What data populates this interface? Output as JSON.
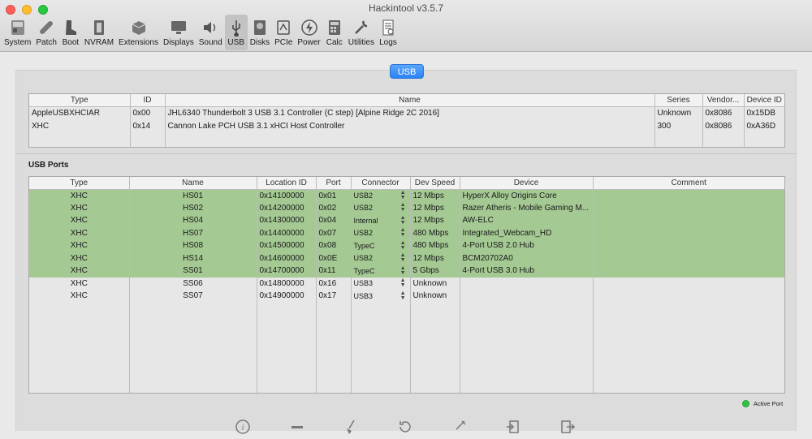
{
  "window": {
    "title": "Hackintool v3.5.7"
  },
  "toolbar": [
    {
      "label": "System",
      "icon": "system-icon"
    },
    {
      "label": "Patch",
      "icon": "patch-icon"
    },
    {
      "label": "Boot",
      "icon": "boot-icon"
    },
    {
      "label": "NVRAM",
      "icon": "nvram-icon"
    },
    {
      "label": "Extensions",
      "icon": "extensions-icon"
    },
    {
      "label": "Displays",
      "icon": "displays-icon"
    },
    {
      "label": "Sound",
      "icon": "sound-icon"
    },
    {
      "label": "USB",
      "icon": "usb-icon",
      "active": true
    },
    {
      "label": "Disks",
      "icon": "disks-icon"
    },
    {
      "label": "PCIe",
      "icon": "pcie-icon"
    },
    {
      "label": "Power",
      "icon": "power-icon"
    },
    {
      "label": "Calc",
      "icon": "calc-icon"
    },
    {
      "label": "Utilities",
      "icon": "utilities-icon"
    },
    {
      "label": "Logs",
      "icon": "logs-icon"
    }
  ],
  "tab_label": "USB",
  "controllers": {
    "headers": [
      "Type",
      "ID",
      "Name",
      "Series",
      "Vendor...",
      "Device ID"
    ],
    "rows": [
      [
        "AppleUSBXHCIAR",
        "0x00",
        "JHL6340 Thunderbolt 3 USB 3.1 Controller (C step) [Alpine Ridge 2C 2016]",
        "Unknown",
        "0x8086",
        "0x15DB"
      ],
      [
        "XHC",
        "0x14",
        "Cannon Lake PCH USB 3.1 xHCI Host Controller",
        "300",
        "0x8086",
        "0xA36D"
      ]
    ]
  },
  "ports": {
    "title": "USB Ports",
    "headers": [
      "Type",
      "Name",
      "Location ID",
      "Port",
      "Connector",
      "Dev Speed",
      "Device",
      "Comment"
    ],
    "rows": [
      {
        "type": "XHC",
        "name": "HS01",
        "location": "0x14100000",
        "port": "0x01",
        "connector": "USB2",
        "speed": "12 Mbps",
        "device": "HyperX Alloy Origins Core",
        "comment": "",
        "active": true
      },
      {
        "type": "XHC",
        "name": "HS02",
        "location": "0x14200000",
        "port": "0x02",
        "connector": "USB2",
        "speed": "12 Mbps",
        "device": "Razer Atheris - Mobile Gaming M...",
        "comment": "",
        "active": true
      },
      {
        "type": "XHC",
        "name": "HS04",
        "location": "0x14300000",
        "port": "0x04",
        "connector": "Internal",
        "speed": "12 Mbps",
        "device": "AW-ELC",
        "comment": "",
        "active": true
      },
      {
        "type": "XHC",
        "name": "HS07",
        "location": "0x14400000",
        "port": "0x07",
        "connector": "USB2",
        "speed": "480 Mbps",
        "device": "Integrated_Webcam_HD",
        "comment": "",
        "active": true
      },
      {
        "type": "XHC",
        "name": "HS08",
        "location": "0x14500000",
        "port": "0x08",
        "connector": "TypeC",
        "speed": "480 Mbps",
        "device": "4-Port USB 2.0 Hub",
        "comment": "",
        "active": true
      },
      {
        "type": "XHC",
        "name": "HS14",
        "location": "0x14600000",
        "port": "0x0E",
        "connector": "USB2",
        "speed": "12 Mbps",
        "device": "BCM20702A0",
        "comment": "",
        "active": true
      },
      {
        "type": "XHC",
        "name": "SS01",
        "location": "0x14700000",
        "port": "0x11",
        "connector": "TypeC",
        "speed": "5 Gbps",
        "device": "4-Port USB 3.0 Hub",
        "comment": "",
        "active": true
      },
      {
        "type": "XHC",
        "name": "SS06",
        "location": "0x14800000",
        "port": "0x16",
        "connector": "USB3",
        "speed": "Unknown",
        "device": "",
        "comment": "",
        "active": false
      },
      {
        "type": "XHC",
        "name": "SS07",
        "location": "0x14900000",
        "port": "0x17",
        "connector": "USB3",
        "speed": "Unknown",
        "device": "",
        "comment": "",
        "active": false
      }
    ]
  },
  "legend": {
    "active_port": "Active Port",
    "active_color": "#2fc240"
  },
  "colors": {
    "active_row": "#a4c993",
    "accent": "#2c82f5"
  },
  "bottom_actions": [
    "info-icon",
    "remove-icon",
    "clean-icon",
    "refresh-icon",
    "inject-icon",
    "import-icon",
    "export-icon"
  ]
}
